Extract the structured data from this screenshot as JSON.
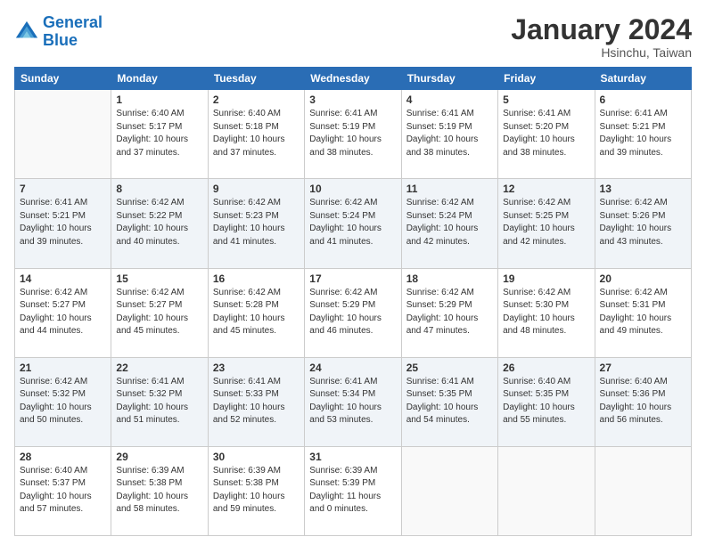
{
  "logo": {
    "line1": "General",
    "line2": "Blue"
  },
  "title": "January 2024",
  "subtitle": "Hsinchu, Taiwan",
  "headers": [
    "Sunday",
    "Monday",
    "Tuesday",
    "Wednesday",
    "Thursday",
    "Friday",
    "Saturday"
  ],
  "weeks": [
    [
      {
        "day": "",
        "info": ""
      },
      {
        "day": "1",
        "info": "Sunrise: 6:40 AM\nSunset: 5:17 PM\nDaylight: 10 hours\nand 37 minutes."
      },
      {
        "day": "2",
        "info": "Sunrise: 6:40 AM\nSunset: 5:18 PM\nDaylight: 10 hours\nand 37 minutes."
      },
      {
        "day": "3",
        "info": "Sunrise: 6:41 AM\nSunset: 5:19 PM\nDaylight: 10 hours\nand 38 minutes."
      },
      {
        "day": "4",
        "info": "Sunrise: 6:41 AM\nSunset: 5:19 PM\nDaylight: 10 hours\nand 38 minutes."
      },
      {
        "day": "5",
        "info": "Sunrise: 6:41 AM\nSunset: 5:20 PM\nDaylight: 10 hours\nand 38 minutes."
      },
      {
        "day": "6",
        "info": "Sunrise: 6:41 AM\nSunset: 5:21 PM\nDaylight: 10 hours\nand 39 minutes."
      }
    ],
    [
      {
        "day": "7",
        "info": "Sunrise: 6:41 AM\nSunset: 5:21 PM\nDaylight: 10 hours\nand 39 minutes."
      },
      {
        "day": "8",
        "info": "Sunrise: 6:42 AM\nSunset: 5:22 PM\nDaylight: 10 hours\nand 40 minutes."
      },
      {
        "day": "9",
        "info": "Sunrise: 6:42 AM\nSunset: 5:23 PM\nDaylight: 10 hours\nand 41 minutes."
      },
      {
        "day": "10",
        "info": "Sunrise: 6:42 AM\nSunset: 5:24 PM\nDaylight: 10 hours\nand 41 minutes."
      },
      {
        "day": "11",
        "info": "Sunrise: 6:42 AM\nSunset: 5:24 PM\nDaylight: 10 hours\nand 42 minutes."
      },
      {
        "day": "12",
        "info": "Sunrise: 6:42 AM\nSunset: 5:25 PM\nDaylight: 10 hours\nand 42 minutes."
      },
      {
        "day": "13",
        "info": "Sunrise: 6:42 AM\nSunset: 5:26 PM\nDaylight: 10 hours\nand 43 minutes."
      }
    ],
    [
      {
        "day": "14",
        "info": "Sunrise: 6:42 AM\nSunset: 5:27 PM\nDaylight: 10 hours\nand 44 minutes."
      },
      {
        "day": "15",
        "info": "Sunrise: 6:42 AM\nSunset: 5:27 PM\nDaylight: 10 hours\nand 45 minutes."
      },
      {
        "day": "16",
        "info": "Sunrise: 6:42 AM\nSunset: 5:28 PM\nDaylight: 10 hours\nand 45 minutes."
      },
      {
        "day": "17",
        "info": "Sunrise: 6:42 AM\nSunset: 5:29 PM\nDaylight: 10 hours\nand 46 minutes."
      },
      {
        "day": "18",
        "info": "Sunrise: 6:42 AM\nSunset: 5:29 PM\nDaylight: 10 hours\nand 47 minutes."
      },
      {
        "day": "19",
        "info": "Sunrise: 6:42 AM\nSunset: 5:30 PM\nDaylight: 10 hours\nand 48 minutes."
      },
      {
        "day": "20",
        "info": "Sunrise: 6:42 AM\nSunset: 5:31 PM\nDaylight: 10 hours\nand 49 minutes."
      }
    ],
    [
      {
        "day": "21",
        "info": "Sunrise: 6:42 AM\nSunset: 5:32 PM\nDaylight: 10 hours\nand 50 minutes."
      },
      {
        "day": "22",
        "info": "Sunrise: 6:41 AM\nSunset: 5:32 PM\nDaylight: 10 hours\nand 51 minutes."
      },
      {
        "day": "23",
        "info": "Sunrise: 6:41 AM\nSunset: 5:33 PM\nDaylight: 10 hours\nand 52 minutes."
      },
      {
        "day": "24",
        "info": "Sunrise: 6:41 AM\nSunset: 5:34 PM\nDaylight: 10 hours\nand 53 minutes."
      },
      {
        "day": "25",
        "info": "Sunrise: 6:41 AM\nSunset: 5:35 PM\nDaylight: 10 hours\nand 54 minutes."
      },
      {
        "day": "26",
        "info": "Sunrise: 6:40 AM\nSunset: 5:35 PM\nDaylight: 10 hours\nand 55 minutes."
      },
      {
        "day": "27",
        "info": "Sunrise: 6:40 AM\nSunset: 5:36 PM\nDaylight: 10 hours\nand 56 minutes."
      }
    ],
    [
      {
        "day": "28",
        "info": "Sunrise: 6:40 AM\nSunset: 5:37 PM\nDaylight: 10 hours\nand 57 minutes."
      },
      {
        "day": "29",
        "info": "Sunrise: 6:39 AM\nSunset: 5:38 PM\nDaylight: 10 hours\nand 58 minutes."
      },
      {
        "day": "30",
        "info": "Sunrise: 6:39 AM\nSunset: 5:38 PM\nDaylight: 10 hours\nand 59 minutes."
      },
      {
        "day": "31",
        "info": "Sunrise: 6:39 AM\nSunset: 5:39 PM\nDaylight: 11 hours\nand 0 minutes."
      },
      {
        "day": "",
        "info": ""
      },
      {
        "day": "",
        "info": ""
      },
      {
        "day": "",
        "info": ""
      }
    ]
  ],
  "row_shades": [
    false,
    true,
    false,
    true,
    false
  ]
}
